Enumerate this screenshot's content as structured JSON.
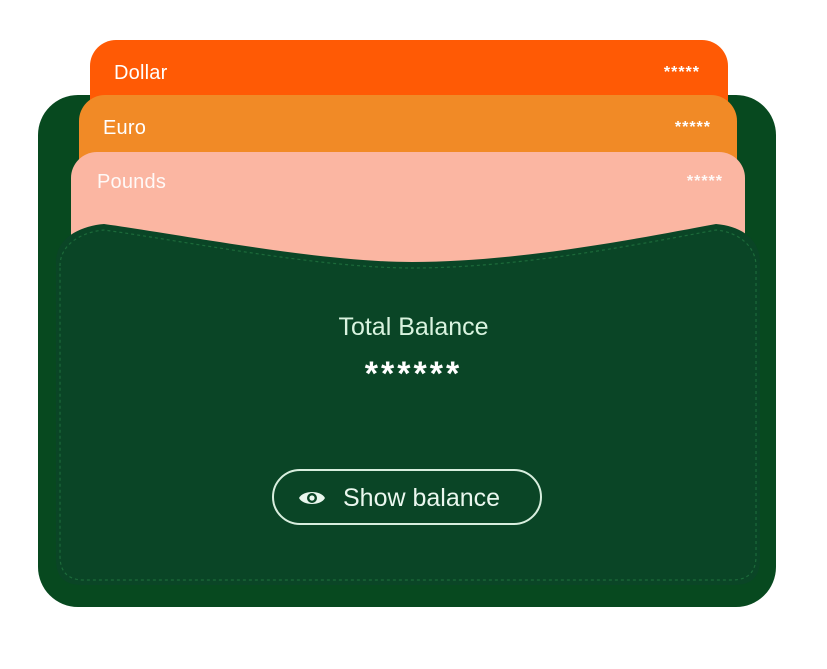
{
  "cards": [
    {
      "label": "Dollar",
      "masked_value": "*****",
      "color": "#ff5a05"
    },
    {
      "label": "Euro",
      "masked_value": "*****",
      "color": "#f18a26"
    },
    {
      "label": "Pounds",
      "masked_value": "*****",
      "color": "#fbb6a2"
    }
  ],
  "wallet": {
    "color": "#07491f",
    "pocket_color": "#0a4526",
    "title": "Total Balance",
    "masked_value": "******",
    "show_button": {
      "label": "Show balance",
      "icon": "eye-icon"
    }
  }
}
